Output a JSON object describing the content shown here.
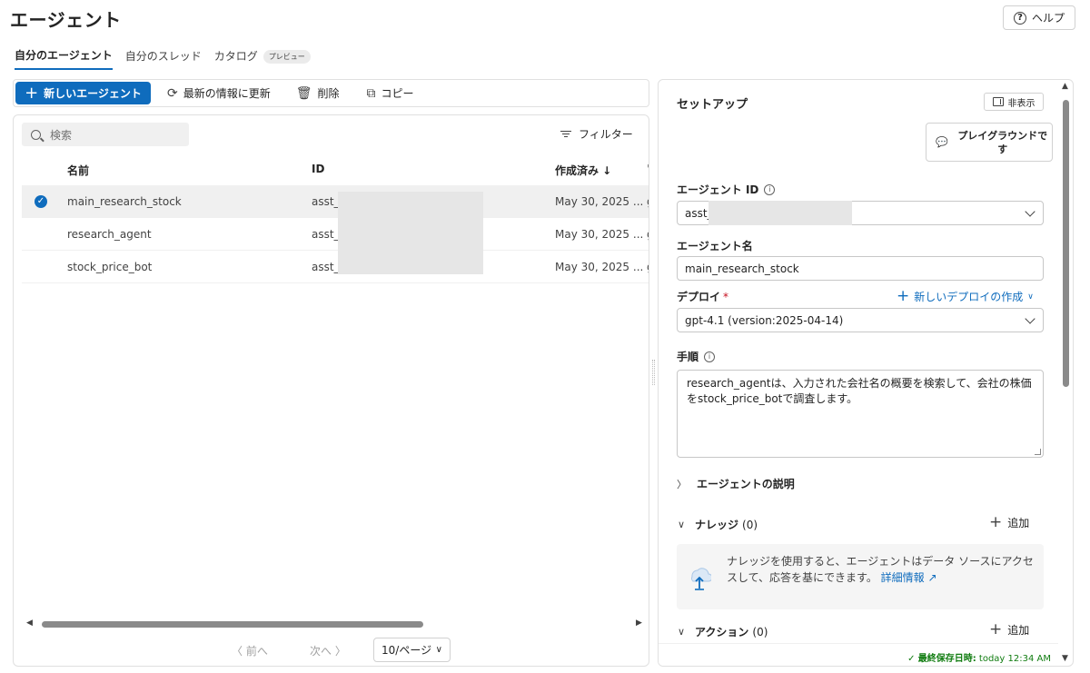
{
  "page": {
    "title": "エージェント",
    "help_label": "ヘルプ"
  },
  "tabs": [
    {
      "label": "自分のエージェント"
    },
    {
      "label": "自分のスレッド"
    },
    {
      "label": "カタログ",
      "badge": "プレビュー"
    }
  ],
  "toolbar": {
    "new_agent_label": "新しいエージェント",
    "refresh_label": "最新の情報に更新",
    "delete_label": "削除",
    "copy_label": "コピー"
  },
  "list": {
    "search_placeholder": "検索",
    "filter_label": "フィルター",
    "columns": [
      "名前",
      "ID",
      "作成済み ↓"
    ],
    "rows": [
      {
        "name": "main_research_stock",
        "id": "asst_J",
        "created": "May 30, 2025 ...",
        "extra": "g",
        "selected": true
      },
      {
        "name": "research_agent",
        "id": "asst_u",
        "created": "May 30, 2025 ...",
        "extra": "g",
        "selected": false
      },
      {
        "name": "stock_price_bot",
        "id": "asst_p",
        "created": "May 30, 2025 ...",
        "extra": "g",
        "selected": false
      }
    ],
    "pager": {
      "prev": "前へ",
      "next": "次へ",
      "page_size": "10/ページ"
    }
  },
  "setup": {
    "title": "セットアップ",
    "hide_label": "非表示",
    "playground_label": "プレイグラウンドで す",
    "agent_id_label": "エージェント ID",
    "agent_id_value": "asst_",
    "agent_name_label": "エージェント名",
    "agent_name_value": "main_research_stock",
    "deploy_label": "デプロイ",
    "deploy_required": "*",
    "new_deploy_label": "新しいデプロイの作成",
    "deploy_value": "gpt-4.1 (version:2025-04-14)",
    "instructions_label": "手順",
    "instructions_value": "research_agentは、入力された会社名の概要を検索して、会社の株価をstock_price_botで調査します。",
    "description_section": "エージェントの説明",
    "knowledge_section": "ナレッジ",
    "knowledge_count": "(0)",
    "add_label": "追加",
    "knowledge_text": "ナレッジを使用すると、エージェントはデータ ソースにアクセスして、応答を基にできます。",
    "knowledge_link": "詳細情報",
    "actions_section": "アクション",
    "actions_count": "(0)",
    "actions_add": "追加",
    "saved_label": "最終保存日時:",
    "saved_time": "today 12:34 AM"
  },
  "colors": {
    "accent": "#0f6cbd",
    "saved": "#107c10",
    "required": "#c50f1f"
  }
}
